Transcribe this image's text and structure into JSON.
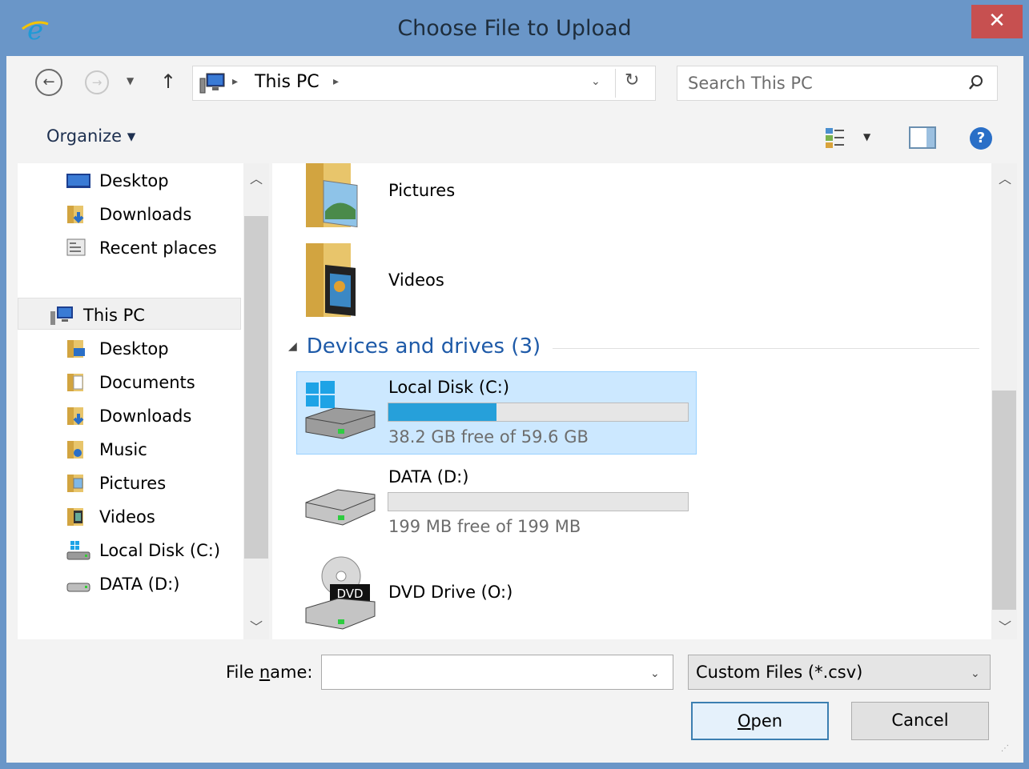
{
  "window": {
    "title": "Choose File to Upload",
    "close_label": "✕",
    "app_icon": "internet-explorer-icon"
  },
  "navbar": {
    "address": "This PC",
    "search_placeholder": "Search This PC"
  },
  "toolbar": {
    "organize_label": "Organize ▾"
  },
  "nav_pane": {
    "items": [
      {
        "label": "Desktop",
        "icon": "desktop-icon"
      },
      {
        "label": "Downloads",
        "icon": "downloads-folder-icon"
      },
      {
        "label": "Recent places",
        "icon": "recent-places-icon"
      },
      {
        "label": "This PC",
        "icon": "this-pc-icon"
      },
      {
        "label": "Desktop",
        "icon": "desktop-folder-icon"
      },
      {
        "label": "Documents",
        "icon": "documents-folder-icon"
      },
      {
        "label": "Downloads",
        "icon": "downloads-folder-icon"
      },
      {
        "label": "Music",
        "icon": "music-folder-icon"
      },
      {
        "label": "Pictures",
        "icon": "pictures-folder-icon"
      },
      {
        "label": "Videos",
        "icon": "videos-folder-icon"
      },
      {
        "label": "Local Disk (C:)",
        "icon": "windows-drive-icon"
      },
      {
        "label": "DATA (D:)",
        "icon": "drive-icon"
      }
    ]
  },
  "content": {
    "folders": [
      {
        "label": "Pictures",
        "icon": "pictures-folder-icon"
      },
      {
        "label": "Videos",
        "icon": "videos-folder-icon"
      }
    ],
    "group_header": "Devices and drives (3)",
    "drives": [
      {
        "name": "Local Disk (C:)",
        "free": "38.2 GB free of 59.6 GB",
        "used_fraction": 0.36,
        "icon": "windows-drive-icon",
        "selected": true
      },
      {
        "name": "DATA (D:)",
        "free": "199 MB free of 199 MB",
        "used_fraction": 0.0,
        "icon": "drive-icon",
        "selected": false
      },
      {
        "name": "DVD Drive (O:)",
        "icon": "dvd-drive-icon",
        "dvd_label": "DVD"
      }
    ]
  },
  "bottom": {
    "filename_label_pre": "File ",
    "filename_label_underline": "n",
    "filename_label_post": "ame:",
    "filename_value": "",
    "filetype": "Custom Files (*.csv)",
    "open_underline": "O",
    "open_rest": "pen",
    "cancel_label": "Cancel"
  },
  "colors": {
    "accent": "#26a0da",
    "selection": "#cce8ff",
    "group_header": "#1e5aa8"
  }
}
